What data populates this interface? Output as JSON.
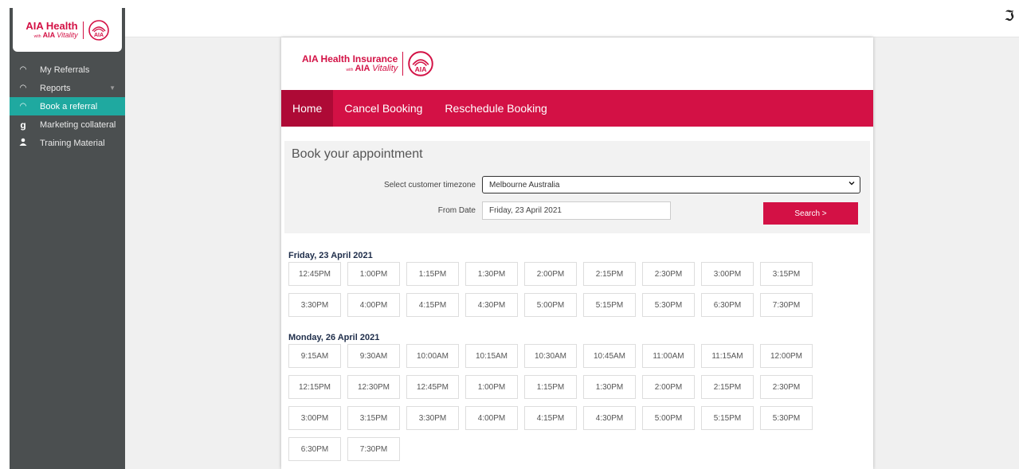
{
  "brand": {
    "name": "AIA Health",
    "full_name": "AIA Health Insurance",
    "with": "with",
    "partner": "AIA",
    "partner_script": "Vitality",
    "accent": "#d31145",
    "active_teal": "#1fa9a0"
  },
  "sidebar": {
    "items": [
      {
        "label": "My Referrals",
        "icon": "dashboard-gauge-icon",
        "glyph": "◠"
      },
      {
        "label": "Reports",
        "icon": "dashboard-gauge-icon",
        "glyph": "◠",
        "caret": "▼"
      },
      {
        "label": "Book a referral",
        "icon": "dashboard-gauge-icon",
        "glyph": "◠"
      },
      {
        "label": "Marketing collateral",
        "icon": "g-letter-icon",
        "glyph": "g"
      },
      {
        "label": "Training Material",
        "icon": "user-icon",
        "glyph": "●"
      }
    ]
  },
  "topbar": {
    "corner_glyph": "ℑ"
  },
  "nav": {
    "home": "Home",
    "cancel": "Cancel Booking",
    "reschedule": "Reschedule Booking"
  },
  "form": {
    "title": "Book your appointment",
    "timezone_label": "Select customer timezone",
    "timezone_value": "Melbourne Australia",
    "date_label": "From Date",
    "date_value": "Friday, 23 April 2021",
    "search_label": "Search >"
  },
  "days": [
    {
      "title": "Friday, 23 April 2021",
      "slots": [
        "12:45PM",
        "1:00PM",
        "1:15PM",
        "1:30PM",
        "2:00PM",
        "2:15PM",
        "2:30PM",
        "3:00PM",
        "3:15PM",
        "3:30PM",
        "4:00PM",
        "4:15PM",
        "4:30PM",
        "5:00PM",
        "5:15PM",
        "5:30PM",
        "6:30PM",
        "7:30PM"
      ]
    },
    {
      "title": "Monday, 26 April 2021",
      "slots": [
        "9:15AM",
        "9:30AM",
        "10:00AM",
        "10:15AM",
        "10:30AM",
        "10:45AM",
        "11:00AM",
        "11:15AM",
        "12:00PM",
        "12:15PM",
        "12:30PM",
        "12:45PM",
        "1:00PM",
        "1:15PM",
        "1:30PM",
        "2:00PM",
        "2:15PM",
        "2:30PM",
        "3:00PM",
        "3:15PM",
        "3:30PM",
        "4:00PM",
        "4:15PM",
        "4:30PM",
        "5:00PM",
        "5:15PM",
        "5:30PM",
        "6:30PM",
        "7:30PM"
      ]
    }
  ]
}
